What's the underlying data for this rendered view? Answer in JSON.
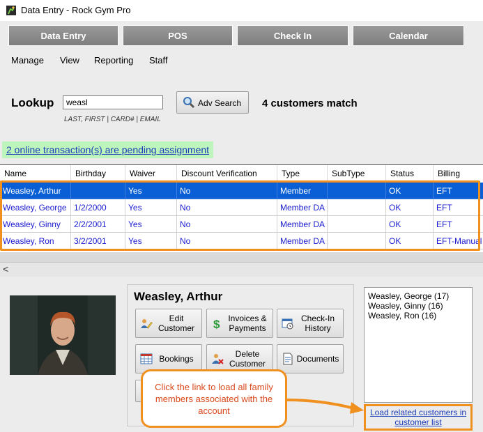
{
  "window": {
    "title": "Data Entry - Rock Gym Pro"
  },
  "topnav": {
    "buttons": [
      "Data Entry",
      "POS",
      "Check In",
      "Calendar"
    ]
  },
  "menu": {
    "items": [
      "Manage",
      "View",
      "Reporting",
      "Staff"
    ]
  },
  "lookup": {
    "label": "Lookup",
    "value": "weasl",
    "hint": "LAST, FIRST | CARD# | EMAIL",
    "adv_search_label": "Adv Search",
    "match_text": "4 customers match"
  },
  "pending_link": "2 online transaction(s) are pending assignment",
  "grid": {
    "columns": [
      "Name",
      "Birthday",
      "Waiver",
      "Discount Verification",
      "Type",
      "SubType",
      "Status",
      "Billing"
    ],
    "rows": [
      [
        "Weasley, Arthur",
        "",
        "Yes",
        "No",
        "Member",
        "",
        "OK",
        "EFT"
      ],
      [
        "Weasley, George",
        "1/2/2000",
        "Yes",
        "No",
        "Member DA",
        "",
        "OK",
        "EFT"
      ],
      [
        "Weasley, Ginny",
        "2/2/2001",
        "Yes",
        "No",
        "Member DA",
        "",
        "OK",
        "EFT"
      ],
      [
        "Weasley, Ron",
        "3/2/2001",
        "Yes",
        "No",
        "Member DA",
        "",
        "OK",
        "EFT-Manual"
      ]
    ],
    "selected_row": 0
  },
  "scroll": {
    "left_arrow": "<"
  },
  "customer": {
    "name": "Weasley, Arthur",
    "actions": {
      "edit": "Edit Customer",
      "invoices": "Invoices & Payments",
      "checkin_history": "Check-In History",
      "bookings": "Bookings",
      "delete": "Delete Customer",
      "documents": "Documents"
    }
  },
  "related": {
    "items": [
      "Weasley, George (17)",
      "Weasley, Ginny (16)",
      "Weasley, Ron (16)"
    ],
    "load_link": "Load related customers in customer list"
  },
  "callout": {
    "text": "Click the link to load all family members associated with the account"
  },
  "colors": {
    "selection": "#0a5fd6",
    "highlight": "#f0901e",
    "link": "#1a3db8",
    "pending_bg": "#bdf5bd",
    "callout_text": "#d94a1c"
  },
  "icons": {
    "app": "climber-icon",
    "adv_search": "magnifier-icon",
    "edit": "pencil-person-icon",
    "invoices": "dollar-icon",
    "checkin": "calendar-clock-icon",
    "bookings": "calendar-grid-icon",
    "delete": "person-x-icon",
    "documents": "document-icon"
  }
}
